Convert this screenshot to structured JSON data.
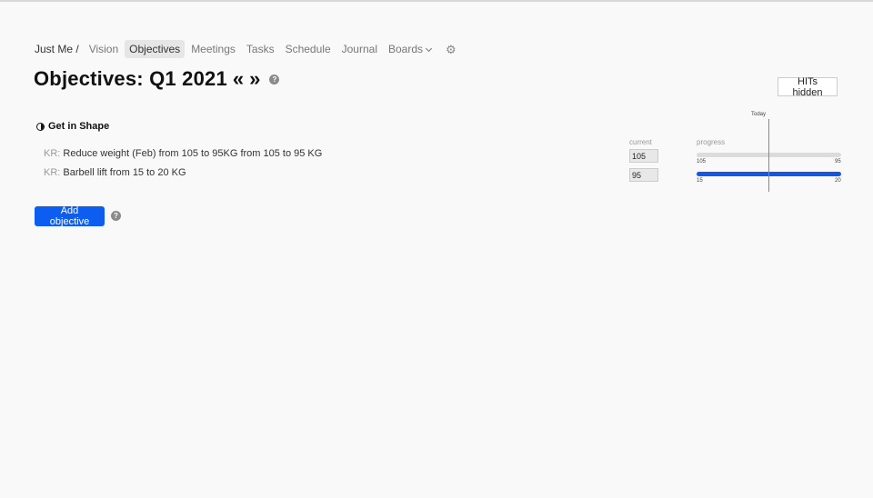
{
  "nav": {
    "breadcrumb": "Just Me /",
    "items": [
      {
        "label": "Vision"
      },
      {
        "label": "Objectives",
        "active": true
      },
      {
        "label": "Meetings"
      },
      {
        "label": "Tasks"
      },
      {
        "label": "Schedule"
      },
      {
        "label": "Journal"
      },
      {
        "label": "Boards"
      }
    ],
    "settings_icon": "gear-icon"
  },
  "page": {
    "title": "Objectives: Q1 2021",
    "prev_glyph": "«",
    "next_glyph": "»",
    "help_glyph": "?",
    "hits_button": "HITs hidden"
  },
  "objective": {
    "name": "Get in Shape",
    "status_icon": "half-circle-icon",
    "columns": {
      "current": "current",
      "progress": "progress"
    },
    "today_label": "Today",
    "key_results": [
      {
        "prefix": "KR:",
        "text": "Reduce weight (Feb) from 105 to 95KG from 105 to 95 KG",
        "current": "105",
        "start": "105",
        "target": "95",
        "progress": 0.0
      },
      {
        "prefix": "KR:",
        "text": "Barbell lift from 15 to 20 KG",
        "current": "95",
        "start": "15",
        "target": "20",
        "progress": 1.0
      }
    ]
  },
  "actions": {
    "add_objective": "Add objective",
    "help_glyph": "?"
  },
  "colors": {
    "accent": "#0d5ef0",
    "today_line": "#e4588a",
    "bar_track": "#dcdcdc"
  }
}
